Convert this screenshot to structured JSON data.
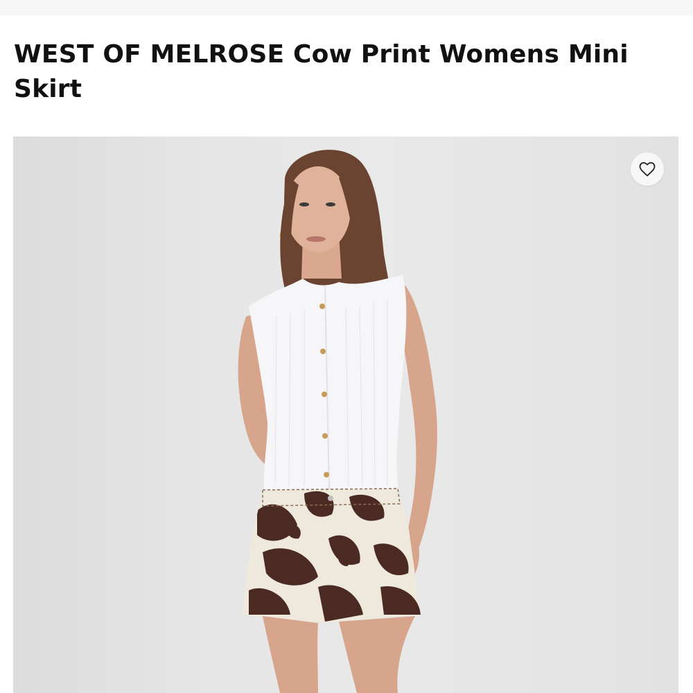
{
  "product": {
    "title": "WEST OF MELROSE Cow Print Womens Mini Skirt"
  },
  "image": {
    "subject": "photo-model-cow-print-mini-skirt"
  },
  "favorite": {
    "icon": "heart-outline-icon"
  },
  "colors": {
    "background": "#ffffff",
    "photo_backdrop": "#e6e6e6",
    "title_text": "#111111",
    "cow_print_dark": "#4a2a22",
    "cow_print_light": "#efe8dc"
  }
}
